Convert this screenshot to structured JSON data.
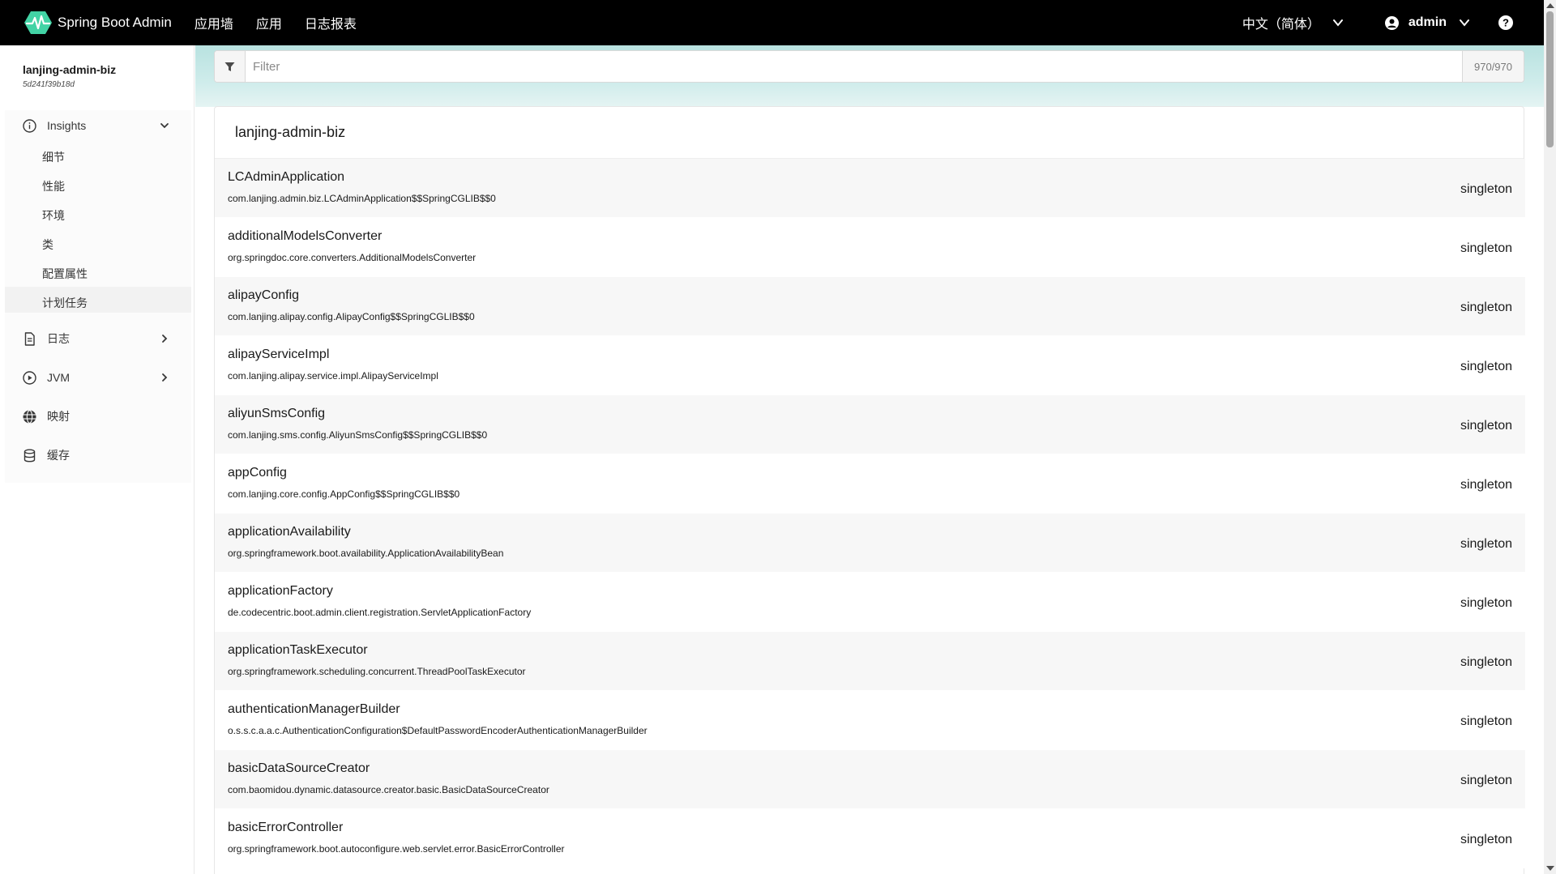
{
  "navbar": {
    "brand": "Spring Boot Admin",
    "links": [
      "应用墙",
      "应用",
      "日志报表"
    ],
    "language": "中文（简体）",
    "user": "admin"
  },
  "sidebar": {
    "instance_name": "lanjing-admin-biz",
    "instance_id": "5d241f39b18d",
    "groups": [
      {
        "label": "Insights",
        "icon": "info-circle-icon",
        "expanded": true
      },
      {
        "label": "日志",
        "icon": "file-icon"
      },
      {
        "label": "JVM",
        "icon": "play-circle-icon"
      },
      {
        "label": "映射",
        "icon": "globe-icon"
      },
      {
        "label": "缓存",
        "icon": "database-icon"
      }
    ],
    "insights_items": [
      "细节",
      "性能",
      "环境",
      "类",
      "配置属性",
      "计划任务"
    ],
    "active_item": "类"
  },
  "filter": {
    "placeholder": "Filter",
    "count": "970/970"
  },
  "card": {
    "title": "lanjing-admin-biz",
    "beans": [
      {
        "name": "LCAdminApplication",
        "type": "com.lanjing.admin.biz.LCAdminApplication$$SpringCGLIB$$0",
        "scope": "singleton"
      },
      {
        "name": "additionalModelsConverter",
        "type": "org.springdoc.core.converters.AdditionalModelsConverter",
        "scope": "singleton"
      },
      {
        "name": "alipayConfig",
        "type": "com.lanjing.alipay.config.AlipayConfig$$SpringCGLIB$$0",
        "scope": "singleton"
      },
      {
        "name": "alipayServiceImpl",
        "type": "com.lanjing.alipay.service.impl.AlipayServiceImpl",
        "scope": "singleton"
      },
      {
        "name": "aliyunSmsConfig",
        "type": "com.lanjing.sms.config.AliyunSmsConfig$$SpringCGLIB$$0",
        "scope": "singleton"
      },
      {
        "name": "appConfig",
        "type": "com.lanjing.core.config.AppConfig$$SpringCGLIB$$0",
        "scope": "singleton"
      },
      {
        "name": "applicationAvailability",
        "type": "org.springframework.boot.availability.ApplicationAvailabilityBean",
        "scope": "singleton"
      },
      {
        "name": "applicationFactory",
        "type": "de.codecentric.boot.admin.client.registration.ServletApplicationFactory",
        "scope": "singleton"
      },
      {
        "name": "applicationTaskExecutor",
        "type": "org.springframework.scheduling.concurrent.ThreadPoolTaskExecutor",
        "scope": "singleton"
      },
      {
        "name": "authenticationManagerBuilder",
        "type": "o.s.s.c.a.a.c.AuthenticationConfiguration$DefaultPasswordEncoderAuthenticationManagerBuilder",
        "scope": "singleton"
      },
      {
        "name": "basicDataSourceCreator",
        "type": "com.baomidou.dynamic.datasource.creator.basic.BasicDataSourceCreator",
        "scope": "singleton"
      },
      {
        "name": "basicErrorController",
        "type": "org.springframework.boot.autoconfigure.web.servlet.error.BasicErrorController",
        "scope": "singleton"
      }
    ]
  },
  "colors": {
    "navbar_bg": "#000000",
    "accent": "#42d3a5",
    "hero_bg": "#b8e2e0"
  }
}
